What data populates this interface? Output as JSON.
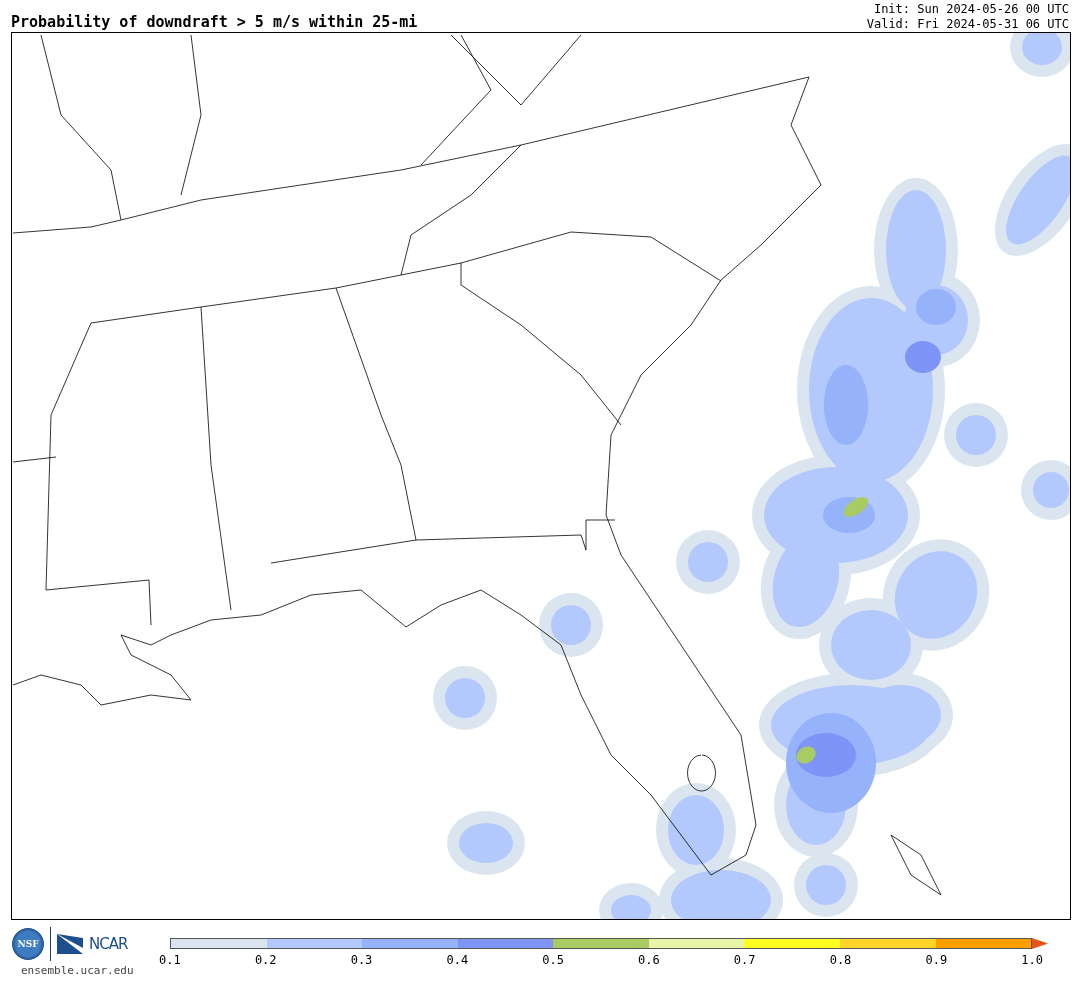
{
  "title": "Probability of downdraft > 5 m/s within 25-mi",
  "init": "Init: Sun 2024-05-26 00 UTC",
  "valid": "Valid: Fri 2024-05-31 06 UTC",
  "logos": {
    "nsf": "NSF",
    "ncar": "NCAR",
    "site": "ensemble.ucar.edu"
  },
  "colorbar": {
    "segments": [
      {
        "color": "#dbe5f0"
      },
      {
        "color": "#b3c8fc"
      },
      {
        "color": "#95b2fb"
      },
      {
        "color": "#7f94f7"
      },
      {
        "color": "#a8cc62"
      },
      {
        "color": "#e8f5a8"
      },
      {
        "color": "#ffff1f"
      },
      {
        "color": "#ffd42a"
      },
      {
        "color": "#ffa000"
      },
      {
        "kind": "arrow",
        "color": "#e8541a"
      }
    ],
    "ticks": [
      "0.1",
      "0.2",
      "0.3",
      "0.4",
      "0.5",
      "0.6",
      "0.7",
      "0.8",
      "0.9",
      "1.0"
    ]
  }
}
